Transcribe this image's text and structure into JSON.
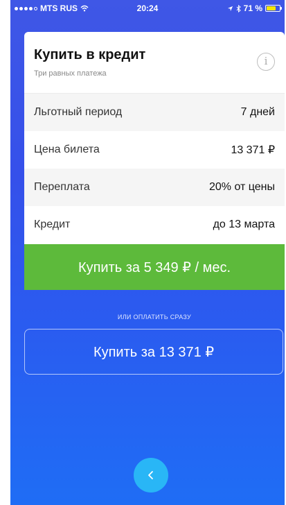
{
  "status_bar": {
    "carrier": "MTS RUS",
    "time": "20:24",
    "battery_percent": "71 %",
    "battery_level": 0.71,
    "signal_icon": "signal-dots-icon",
    "wifi_icon": "wifi-icon",
    "location_icon": "location-arrow-icon",
    "bluetooth_icon": "bluetooth-icon"
  },
  "card": {
    "title": "Купить в кредит",
    "subtitle": "Три равных платежа",
    "info_icon": "info-icon",
    "rows": [
      {
        "label": "Льготный период",
        "value": "7 дней"
      },
      {
        "label": "Цена билета",
        "value": "13 371 ₽"
      },
      {
        "label": "Переплата",
        "value": "20% от цены"
      },
      {
        "label": "Кредит",
        "value": "до 13 марта"
      }
    ],
    "credit_button_label": "Купить за 5 349 ₽ / мес."
  },
  "or_pay_now": "или оплатить сразу",
  "pay_full_button_label": "Купить за 13 371 ₽",
  "back_icon": "chevron-left-icon",
  "colors": {
    "background_top": "#3f57e6",
    "background_bottom": "#1f6df5",
    "credit_button": "#5dba3b",
    "back_button": "#29b6f6"
  }
}
